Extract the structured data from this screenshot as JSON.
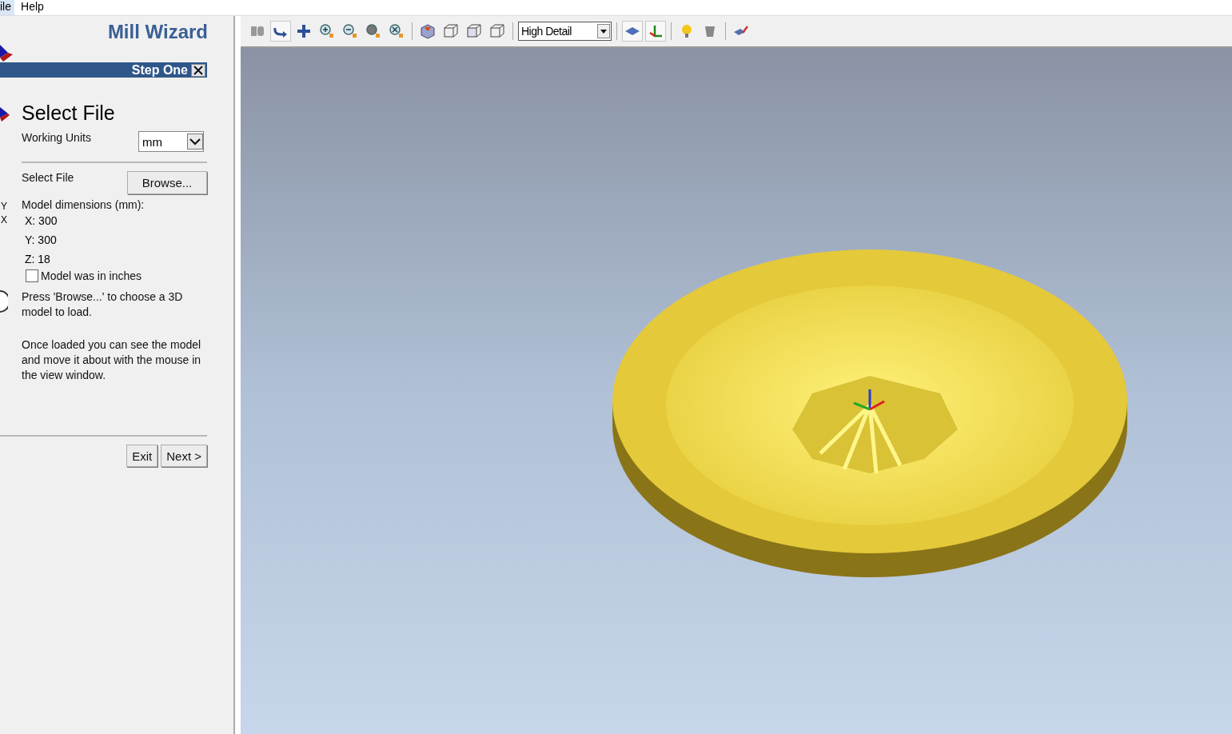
{
  "menu": [
    {
      "label": "ile",
      "selected": true
    },
    {
      "label": "Help",
      "selected": false
    }
  ],
  "toolbar": [
    {
      "kind": "button",
      "selected": false
    },
    {
      "kind": "button",
      "selected": true
    },
    {
      "kind": "button",
      "selected": false
    },
    {
      "kind": "button",
      "selected": false
    },
    {
      "kind": "button",
      "selected": false
    },
    {
      "kind": "button",
      "selected": false
    },
    {
      "kind": "button",
      "selected": false
    },
    {
      "kind": "separator"
    },
    {
      "kind": "button",
      "selected": false
    },
    {
      "kind": "button",
      "selected": false
    },
    {
      "kind": "button",
      "selected": false
    },
    {
      "kind": "button",
      "selected": false
    },
    {
      "kind": "separator"
    },
    {
      "kind": "dropdown",
      "value": "High Detail"
    },
    {
      "kind": "separator"
    },
    {
      "kind": "button",
      "selected": true
    },
    {
      "kind": "button",
      "selected": true
    },
    {
      "kind": "separator"
    },
    {
      "kind": "button",
      "selected": false
    },
    {
      "kind": "button",
      "selected": false
    },
    {
      "kind": "separator"
    },
    {
      "kind": "button",
      "selected": false
    }
  ],
  "wizard": {
    "title": "Mill Wizard",
    "step": "Step One",
    "heading": "Select File",
    "units": {
      "label": "Working Units",
      "value": "mm"
    },
    "file": {
      "label": "Select File",
      "button": "Browse..."
    },
    "axis_labels": [
      "Y",
      "X"
    ],
    "dimensions": {
      "title": "Model dimensions (mm):",
      "values": [
        "X: 300",
        "Y: 300",
        "Z: 18"
      ]
    },
    "inches": {
      "label": "Model was in inches",
      "checked": false
    },
    "help": [
      "Press 'Browse...' to choose a 3D model to load.",
      "Once loaded you can see the model and move it about with the mouse in the view window."
    ],
    "buttons": [
      "Exit",
      "Next >"
    ]
  }
}
